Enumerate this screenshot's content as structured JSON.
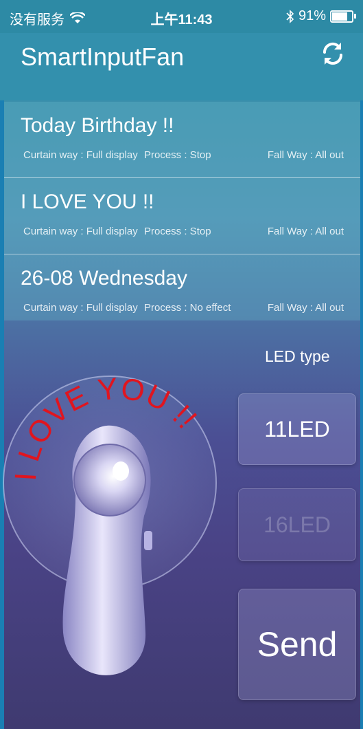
{
  "status_bar": {
    "carrier": "没有服务",
    "time": "上午11:43",
    "bluetooth_icon": "bluetooth-icon",
    "battery_text": "91%",
    "battery_level": 0.91
  },
  "header": {
    "title": "SmartInputFan",
    "refresh_icon": "refresh-icon"
  },
  "list": [
    {
      "title": "Today Birthday !!",
      "curtain": "Curtain way : Full display",
      "process": "Process : Stop",
      "fall": "Fall Way : All out"
    },
    {
      "title": "I LOVE YOU !!",
      "curtain": "Curtain way : Full display",
      "process": "Process : Stop",
      "fall": "Fall Way : All out"
    },
    {
      "title": "26-08 Wednesday",
      "curtain": "Curtain way : Full display",
      "process": "Process : No effect",
      "fall": "Fall Way : All out"
    }
  ],
  "preview": {
    "text": "I LOVE YOU !!",
    "text_color": "#e0151f"
  },
  "controls": {
    "led_type_label": "LED type",
    "led_11": "11LED",
    "led_16": "16LED",
    "send": "Send"
  }
}
